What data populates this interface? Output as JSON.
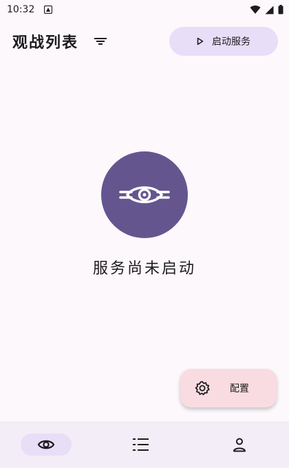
{
  "status_bar": {
    "time": "10:32"
  },
  "header": {
    "title": "观战列表",
    "start_label": "启动服务"
  },
  "empty_state": {
    "message": "服务尚未启动"
  },
  "fab": {
    "label": "配置"
  },
  "colors": {
    "accent": "#65558f",
    "tonal": "#e8def8",
    "fab": "#f9dce1",
    "nav_bg": "#f3edf7"
  },
  "bottom_nav": {
    "items": [
      "eye-icon",
      "list-icon",
      "person-icon"
    ],
    "active_index": 0
  }
}
